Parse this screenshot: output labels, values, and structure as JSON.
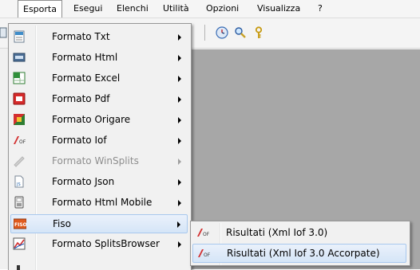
{
  "menubar": {
    "items": [
      {
        "label": "Esporta"
      },
      {
        "label": "Esegui"
      },
      {
        "label": "Elenchi"
      },
      {
        "label": "Utilità"
      },
      {
        "label": "Opzioni"
      },
      {
        "label": "Visualizza"
      },
      {
        "label": "?"
      }
    ]
  },
  "toolbar": {
    "icons": [
      "clock-icon",
      "search-icon",
      "key-icon"
    ]
  },
  "export_menu": {
    "items": [
      {
        "label": "Formato Txt",
        "icon": "txt-file-icon"
      },
      {
        "label": "Formato Html",
        "icon": "html-file-icon"
      },
      {
        "label": "Formato Excel",
        "icon": "excel-icon"
      },
      {
        "label": "Formato Pdf",
        "icon": "pdf-icon"
      },
      {
        "label": "Formato Origare",
        "icon": "origare-icon"
      },
      {
        "label": "Formato Iof",
        "icon": "iof-icon"
      },
      {
        "label": "Formato WinSplits",
        "icon": "winsplits-icon",
        "disabled": true
      },
      {
        "label": "Formato Json",
        "icon": "json-file-icon"
      },
      {
        "label": "Formato Html Mobile",
        "icon": "mobile-icon"
      },
      {
        "label": "Fiso",
        "icon": "fiso-icon",
        "highlighted": true
      },
      {
        "label": "Formato SplitsBrowser",
        "icon": "splitsbrowser-icon"
      }
    ]
  },
  "fiso_submenu": {
    "items": [
      {
        "label": "Risultati (Xml Iof 3.0)",
        "icon": "iof-icon"
      },
      {
        "label": "Risultati (Xml Iof 3.0 Accorpate)",
        "icon": "iof-icon",
        "highlighted": true
      }
    ]
  },
  "colors": {
    "highlight_border": "#a8c8ee",
    "menu_bg": "#f1f1f1",
    "workspace": "#a7a7a7"
  }
}
